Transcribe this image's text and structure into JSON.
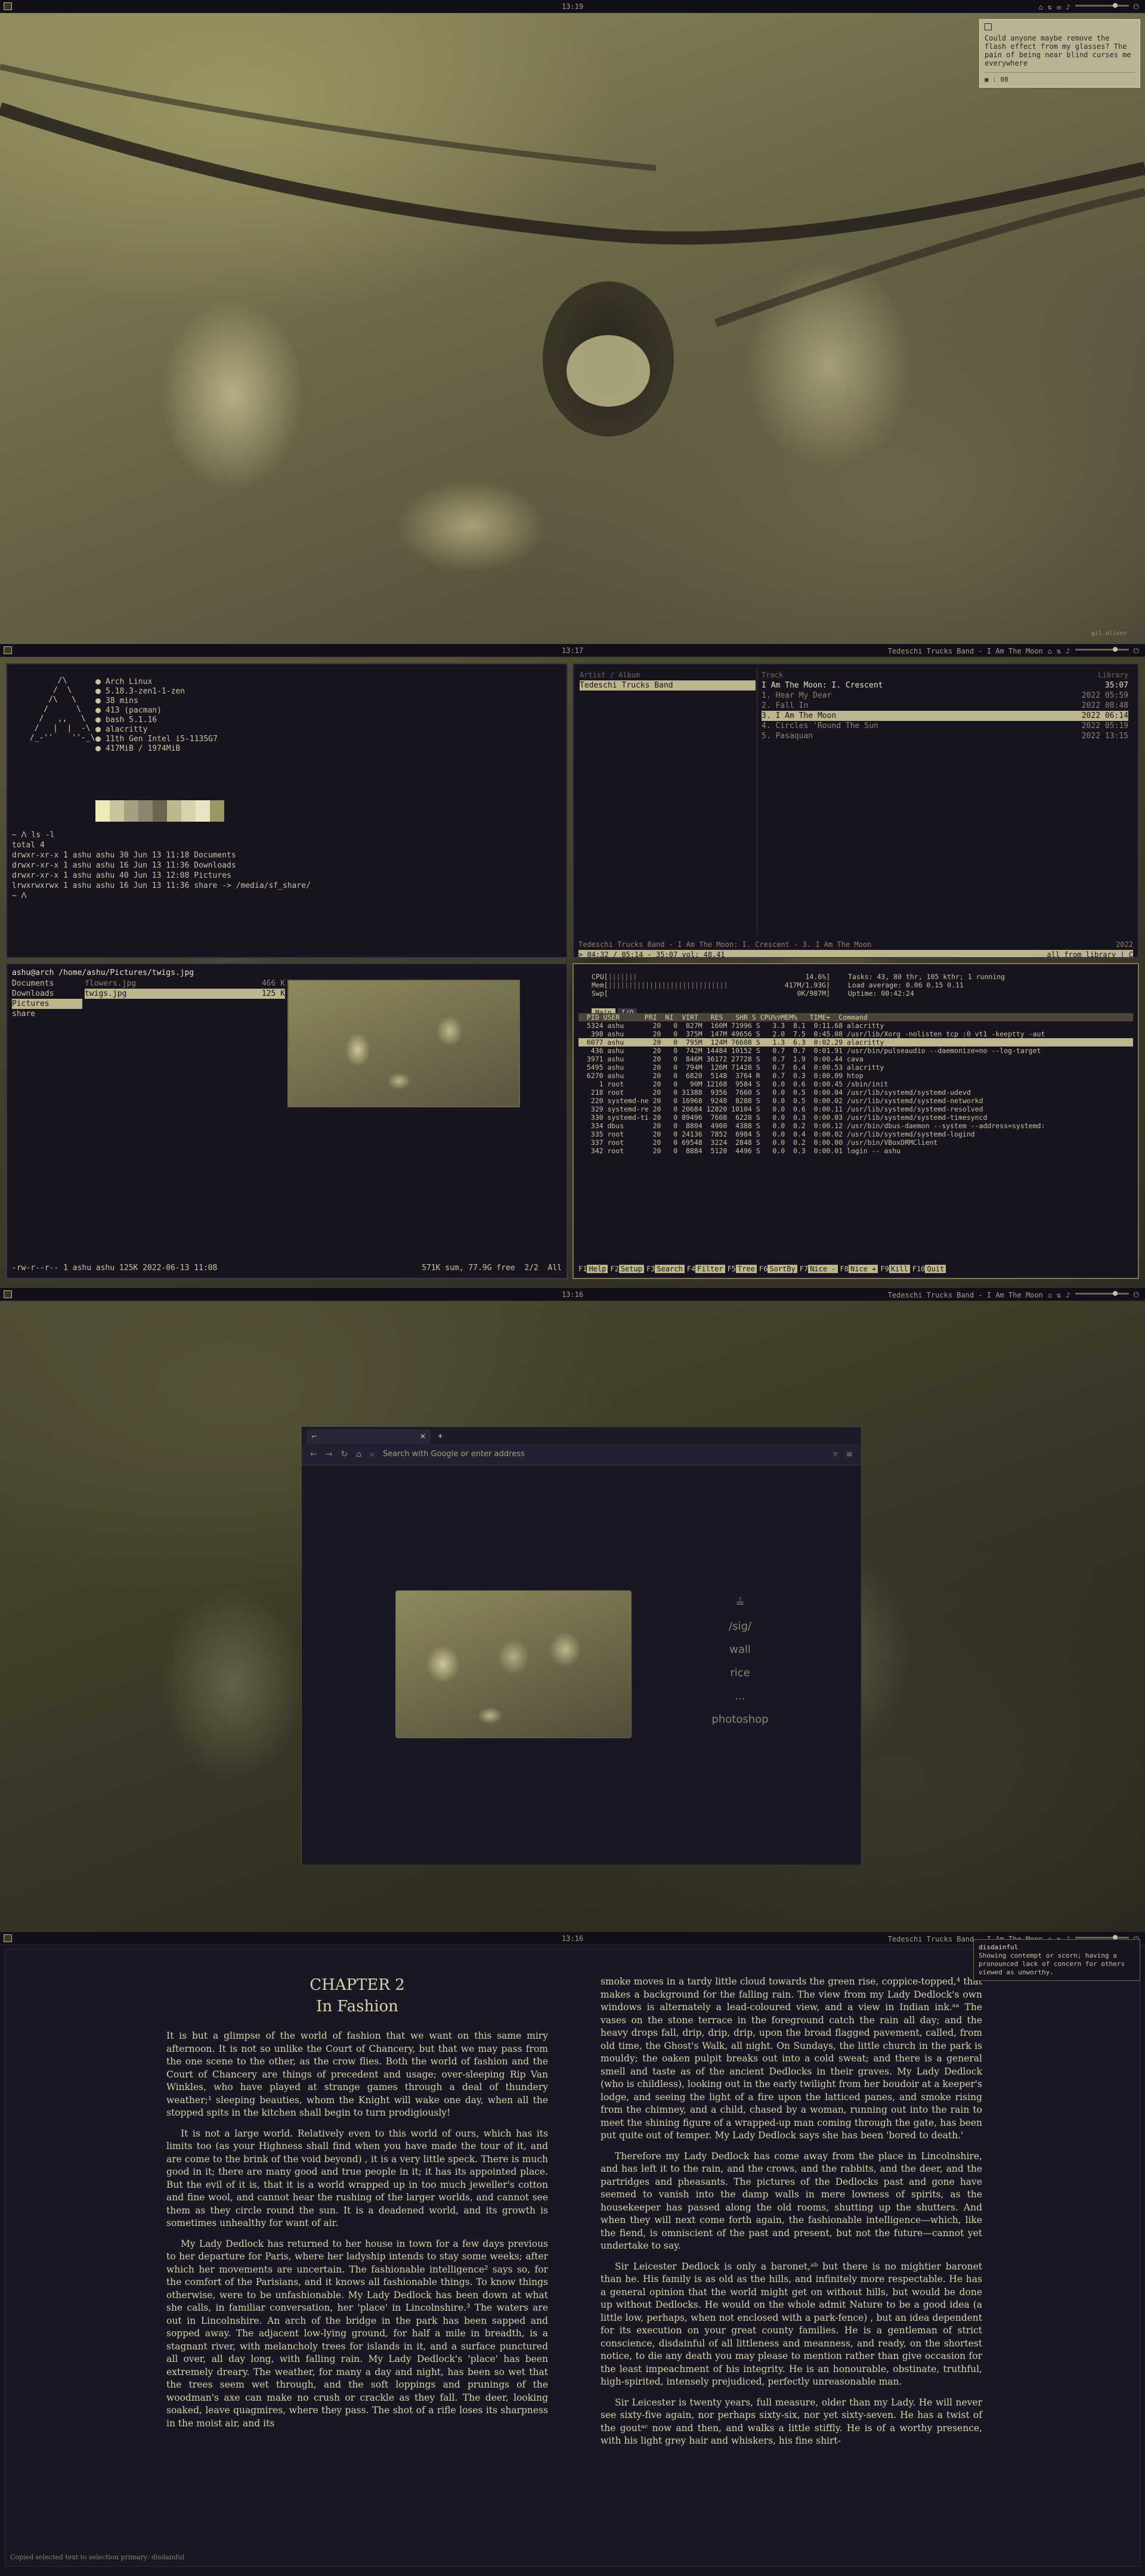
{
  "colors": {
    "bg": "#17141f",
    "fg": "#c9c3a0",
    "accent": "#bdb68c",
    "border": "#3a3548"
  },
  "panel": {
    "workspace_icon": "square-icon",
    "tray": {
      "lock_icon": "lock-icon",
      "net_icon": "network-icon",
      "mail_icon": "mail-icon",
      "vol_icon": "volume-icon",
      "power_icon": "power-icon"
    },
    "now_playing": "Tedeschi Trucks Band - I Am The Moon"
  },
  "clocks": [
    "13:19",
    "13:17",
    "13:16",
    "13:16"
  ],
  "watermark": "gil.oliver",
  "notification": {
    "text": "Could anyone maybe remove the flash effect from my glasses? The pain of being near blind curses me everywhere",
    "footer": "08"
  },
  "fetch": {
    "ascii": [
      "       /\\",
      "      /  \\",
      "     /\\   \\",
      "    /      \\",
      "   /   ,,   \\",
      "  /   |  |  -\\",
      " /_-''    ''-_\\"
    ],
    "info": [
      "Arch Linux",
      "5.18.3-zen1-1-zen",
      "38 mins",
      "413 (pacman)",
      "bash 5.1.16",
      "alacritty",
      "11th Gen Intel i5-1135G7",
      "417MiB / 1974MiB"
    ],
    "palette": [
      "#eeeab8",
      "#c9c3a0",
      "#a59f80",
      "#8a8470",
      "#6c6650",
      "#bdb68c",
      "#d8d2a8",
      "#e8e4c4",
      "#9a9562"
    ],
    "shell": [
      "~ ᐱ ls -l",
      "total 4",
      "drwxr-xr-x 1 ashu ashu 30 Jun 13 11:18 Documents",
      "drwxr-xr-x 1 ashu ashu 16 Jun 13 11:36 Downloads",
      "drwxr-xr-x 1 ashu ashu 40 Jun 13 12:08 Pictures",
      "lrwxrwxrwx 1 ashu ashu 16 Jun 13 11:36 share -> /media/sf_share/",
      "~ ᐱ "
    ]
  },
  "music": {
    "col1": "Artist / Album",
    "col2": "Track",
    "col3": "Library",
    "artist": "Tedeschi Trucks Band",
    "album_header": "I Am The Moon: I. Crescent",
    "album_len": "35:07",
    "tracks": [
      {
        "name": "1. Hear My Dear",
        "time": "2022 05:59"
      },
      {
        "name": "2. Fall In",
        "time": "2022 08:48"
      },
      {
        "name": "3. I Am The Moon",
        "time": "2022 06:14"
      },
      {
        "name": "4. Circles 'Round The Sun",
        "time": "2022 05:19"
      },
      {
        "name": "5. Pasaquan",
        "time": "2022 13:15"
      }
    ],
    "current_index": 2,
    "status_line": "Tedeschi Trucks Band - I Am The Moon: I. Crescent - 3. I Am The Moon",
    "status_year": "2022",
    "progress": "> 04:32 / 05:14 - 35:07 vol: 48,41",
    "progress_right": "all from library | C"
  },
  "lf": {
    "path": "ashu@arch /home/ashu/Pictures/twigs.jpg",
    "parent": [
      "Documents",
      "Downloads",
      "Pictures",
      "share"
    ],
    "parent_selected": 2,
    "files": [
      {
        "name": "flowers.jpg",
        "size": "466 K"
      },
      {
        "name": "twigs.jpg",
        "size": "125 K"
      }
    ],
    "file_selected": 1,
    "status_left": "-rw-r--r-- 1 ashu ashu 125K 2022-06-13 11:08",
    "status_right": "571K sum, 77.9G free  2/2  All"
  },
  "htop": {
    "cpu_label": "CPU",
    "cpu_val": "14.6%",
    "mem_label": "Mem",
    "mem_val": "417M/1.93G",
    "swp_label": "Swp",
    "swp_val": "0K/987M",
    "tasks": "Tasks: 43, 80 thr, 105 kthr; 1 running",
    "load": "Load average: 0.06 0.15 0.11",
    "uptime": "Uptime: 00:42:24",
    "tabs": [
      "Main",
      "I/O"
    ],
    "header": "  PID USER      PRI  NI  VIRT   RES   SHR S CPU%▽MEM%   TIME+  Command",
    "rows": [
      "  5324 ashu       20   0  827M  160M 71996 S   3.3  8.1  0:11.68 alacritty",
      "   398 ashu       20   0  375M  147M 49656 S   2.0  7.5  0:45.08 /usr/lib/Xorg -nolisten tcp :0 vt1 -keeptty -aut",
      "  6077 ashu       20   0  795M  124M 76608 S   1.3  6.3  0:02.29 alacritty",
      "   436 ashu       20   0  742M 14484 10152 S   0.7  0.7  0:01.91 /usr/bin/pulseaudio --daemonize=no --log-target",
      "  3971 ashu       20   0  846M 36172 27728 S   0.7  1.9  0:00.44 cava",
      "  5495 ashu       20   0  794M  126M 71428 S   0.7  6.4  0:00.53 alacritty",
      "  6270 ashu       20   0  6820  5148  3764 R   0.7  0.3  0:00.09 htop",
      "     1 root       20   0   90M 12168  9584 S   0.0  0.6  0:00.45 /sbin/init",
      "   218 root       20   0 31388  9356  7660 S   0.0  0.5  0:00.04 /usr/lib/systemd/systemd-udevd",
      "   220 systemd-ne 20   0 16968  9248  8288 S   0.0  0.5  0:00.02 /usr/lib/systemd/systemd-networkd",
      "   329 systemd-re 20   0 20684 12820 10104 S   0.0  0.6  0:00.11 /usr/lib/systemd/systemd-resolved",
      "   330 systemd-ti 20   0 89496  7608  6228 S   0.0  0.3  0:00.03 /usr/lib/systemd/systemd-timesyncd",
      "   334 dbus       20   0  8804  4900  4388 S   0.0  0.2  0:00.12 /usr/bin/dbus-daemon --system --address=systemd:",
      "   335 root       20   0 24136  7852  6984 S   0.0  0.4  0:00.02 /usr/lib/systemd/systemd-logind",
      "   337 root       20   0 69548  3224  2848 S   0.0  0.2  0:00.00 /usr/bin/VBoxDRMClient",
      "   342 root       20   0  8884  5120  4496 S   0.0  0.3  0:00.01 login -- ashu"
    ],
    "selected_row": 2,
    "fkeys": [
      [
        "F1",
        "Help"
      ],
      [
        "F2",
        "Setup"
      ],
      [
        "F3",
        "Search"
      ],
      [
        "F4",
        "Filter"
      ],
      [
        "F5",
        "Tree"
      ],
      [
        "F6",
        "SortBy"
      ],
      [
        "F7",
        "Nice -"
      ],
      [
        "F8",
        "Nice +"
      ],
      [
        "F9",
        "Kill"
      ],
      [
        "F10",
        "Quit"
      ]
    ]
  },
  "browser": {
    "tab_title": "",
    "url_placeholder": "Search with Google or enter address",
    "links": [
      "≟",
      "/sig/",
      "wall",
      "rice",
      "...",
      "photoshop"
    ]
  },
  "reader": {
    "chapter": "CHAPTER 2",
    "title": "In Fashion",
    "col1": [
      "It is but a glimpse of the world of fashion that we want on this same miry afternoon. It is not so unlike the Court of Chancery, but that we may pass from the one scene to the other, as the crow flies. Both the world of fashion and the Court of Chancery are things of precedent and usage; over-sleeping Rip Van Winkles, who have played at strange games through a deal of thundery weather;¹ sleeping beauties, whom the Knight will wake one day, when all the stopped spits in the kitchen shall begin to turn prodigiously!",
      "It is not a large world. Relatively even to this world of ours, which has its limits too (as your Highness shall find when you have made the tour of it, and are come to the brink of the void beyond) , it is a very little speck. There is much good in it; there are many good and true people in it; it has its appointed place. But the evil of it is, that it is a world wrapped up in too much jeweller's cotton and fine wool, and cannot hear the rushing of the larger worlds, and cannot see them as they circle round the sun. It is a deadened world, and its growth is sometimes unhealthy for want of air.",
      "My Lady Dedlock has returned to her house in town for a few days previous to her departure for Paris, where her ladyship intends to stay some weeks; after which her movements are uncertain. The fashionable intelligence² says so, for the comfort of the Parisians, and it knows all fashionable things. To know things otherwise, were to be unfashionable. My Lady Dedlock has been down at what she calls, in familiar conversation, her 'place' in Lincolnshire.³ The waters are out in Lincolnshire. An arch of the bridge in the park has been sapped and sopped away. The adjacent low-lying ground, for half a mile in breadth, is a stagnant river, with melancholy trees for islands in it, and a surface punctured all over, all day long, with falling rain. My Lady Dedlock's 'place' has been extremely dreary. The weather, for many a day and night, has been so wet that the trees seem wet through, and the soft loppings and prunings of the woodman's axe can make no crush or crackle as they fall. The deer, looking soaked, leave quagmires, where they pass. The shot of a rifle loses its sharpness in the moist air, and its"
    ],
    "col2": [
      "smoke moves in a tardy little cloud towards the green rise, coppice-topped,⁴ that makes a background for the falling rain. The view from my Lady Dedlock's own windows is alternately a lead-coloured view, and a view in Indian ink.ᵃᵃ The vases on the stone terrace in the foreground catch the rain all day; and the heavy drops fall, drip, drip, drip, upon the broad flagged pavement, called, from old time, the Ghost's Walk, all night. On Sundays, the little church in the park is mouldy; the oaken pulpit breaks out into a cold sweat; and there is a general smell and taste as of the ancient Dedlocks in their graves. My Lady Dedlock (who is childless), looking out in the early twilight from her boudoir at a keeper's lodge, and seeing the light of a fire upon the latticed panes, and smoke rising from the chimney, and a child, chased by a woman, running out into the rain to meet the shining figure of a wrapped-up man coming through the gate, has been put quite out of temper. My Lady Dedlock says she has been 'bored to death.'",
      "Therefore my Lady Dedlock has come away from the place in Lincolnshire, and has left it to the rain, and the crows, and the rabbits, and the deer, and the partridges and pheasants. The pictures of the Dedlocks past and gone have seemed to vanish into the damp walls in mere lowness of spirits, as the housekeeper has passed along the old rooms, shutting up the shutters. And when they will next come forth again, the fashionable intelligence—which, like the fiend, is omniscient of the past and present, but not the future—cannot yet undertake to say.",
      "Sir Leicester Dedlock is only a baronet,ᵃᵇ but there is no mightier baronet than he. His family is as old as the hills, and infinitely more respectable. He has a general opinion that the world might get on without hills, but would be done up without Dedlocks. He would on the whole admit Nature to be a good idea (a little low, perhaps, when not enclosed with a park-fence) , but an idea dependent for its execution on your great county families. He is a gentleman of strict conscience, disdainful of all littleness and meanness, and ready, on the shortest notice, to die any death you may please to mention rather than give occasion for the least impeachment of his integrity. He is an honourable, obstinate, truthful, high-spirited, intensely prejudiced, perfectly unreasonable man.",
      "Sir Leicester is twenty years, full measure, older than my Lady. He will never see sixty-five again, nor perhaps sixty-six, nor yet sixty-seven. He has a twist of the goutᵃᶜ now and then, and walks a little stiffly. He is of a worthy presence, with his light grey hair and whiskers, his fine shirt-"
    ],
    "dict_word": "disdainful",
    "dict_def": "Showing contempt or scorn; having a pronounced lack of concern for others viewed as unworthy.",
    "status": "Copied selected text to selection primary: disdainful"
  }
}
